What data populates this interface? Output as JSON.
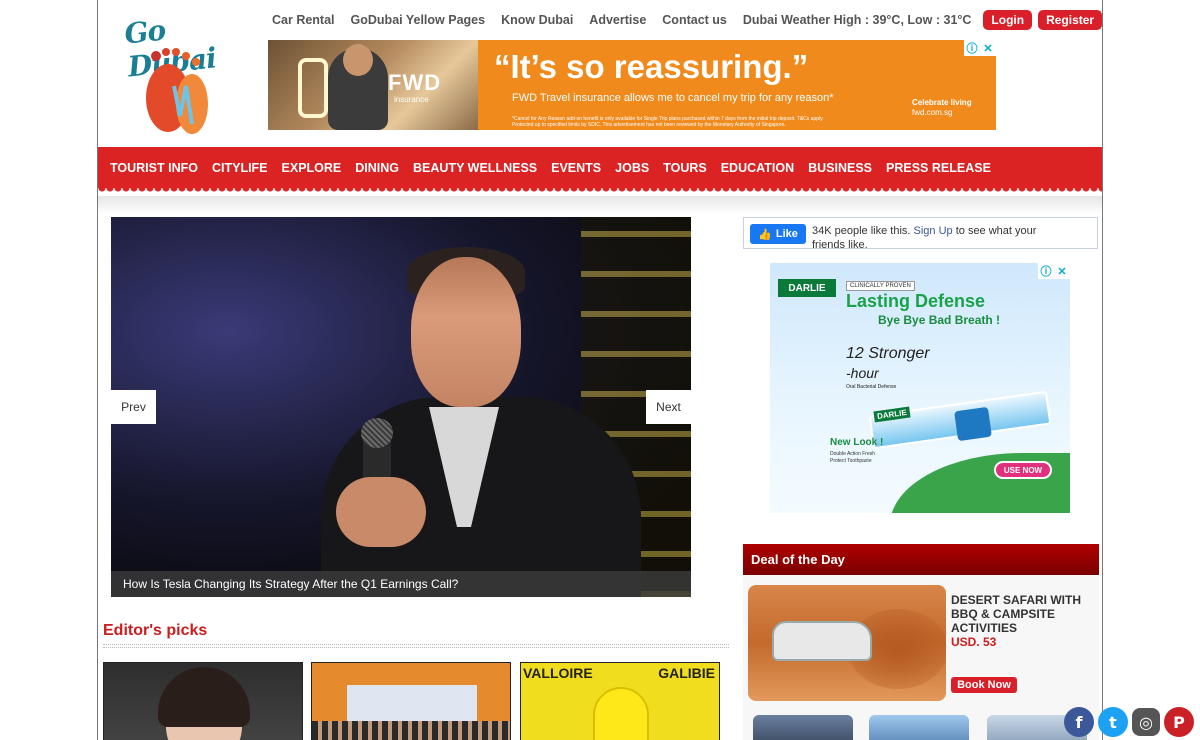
{
  "logo": {
    "text": "Go Dubai"
  },
  "top_links": [
    "Car Rental",
    "GoDubai Yellow Pages",
    "Know Dubai",
    "Advertise",
    "Contact us"
  ],
  "weather": "Dubai Weather High : 39°C, Low : 31°C",
  "auth": {
    "login": "Login",
    "register": "Register"
  },
  "ad_top": {
    "brand": "FWD",
    "brand_sub": "insurance",
    "headline": "“It’s so reassuring.”",
    "desc": "FWD Travel insurance allows me to cancel my trip for any reason*",
    "small_print": "*Cancel for Any Reason add-on benefit is only available for Single Trip plans purchased within 7 days from the initial trip deposit. T&Cs apply. Protected up to specified limits by SDIC. This advertisement has not been reviewed by the Monetary Authority of Singapore.",
    "cta_line1": "Celebrate living",
    "cta_line2": "fwd.com.sg",
    "info_icon": "ⓘ",
    "close_icon": "✕"
  },
  "nav": [
    "TOURIST INFO",
    "CITYLIFE",
    "EXPLORE",
    "DINING",
    "BEAUTY WELLNESS",
    "EVENTS",
    "JOBS",
    "TOURS",
    "EDUCATION",
    "BUSINESS",
    "PRESS RELEASE"
  ],
  "slider": {
    "caption": "How Is Tesla Changing Its Strategy After the Q1 Earnings Call?",
    "prev": "Prev",
    "next": "Next"
  },
  "editors_picks": {
    "title": "Editor's picks",
    "pick3_left": "VALLOIRE",
    "pick3_right": "GALIBIE"
  },
  "fb_like": {
    "button": "Like",
    "text_before": "34K people like this. ",
    "signup": "Sign Up",
    "text_after": " to see what your friends like."
  },
  "ad_side": {
    "brand": "DARLIE",
    "clinically": "CLINICALLY PROVEN",
    "headline1": "Lasting Defense",
    "headline2": "Bye Bye Bad Breath !",
    "hour_line1": "12 Stronger",
    "hour_line2": "-hour",
    "hour_sub": "Oral Bacterial Defense",
    "new_look": "New Look !",
    "new_sub": "Double Action Fresh Protect Toothpaste",
    "use_now": "USE NOW",
    "info_icon": "ⓘ",
    "close_icon": "✕"
  },
  "deal": {
    "heading": "Deal of the Day",
    "title": "DESERT SAFARI WITH BBQ & CAMPSITE ACTIVITIES",
    "price": "USD. 53",
    "book": "Book Now"
  },
  "social": {
    "facebook": "f",
    "twitter": "t",
    "instagram": "◎",
    "pinterest": "P"
  },
  "colors": {
    "brand_red": "#db2324",
    "logo_teal": "#1a7f95",
    "ad_orange": "#f08a1c",
    "deal_red": "#b00000"
  }
}
